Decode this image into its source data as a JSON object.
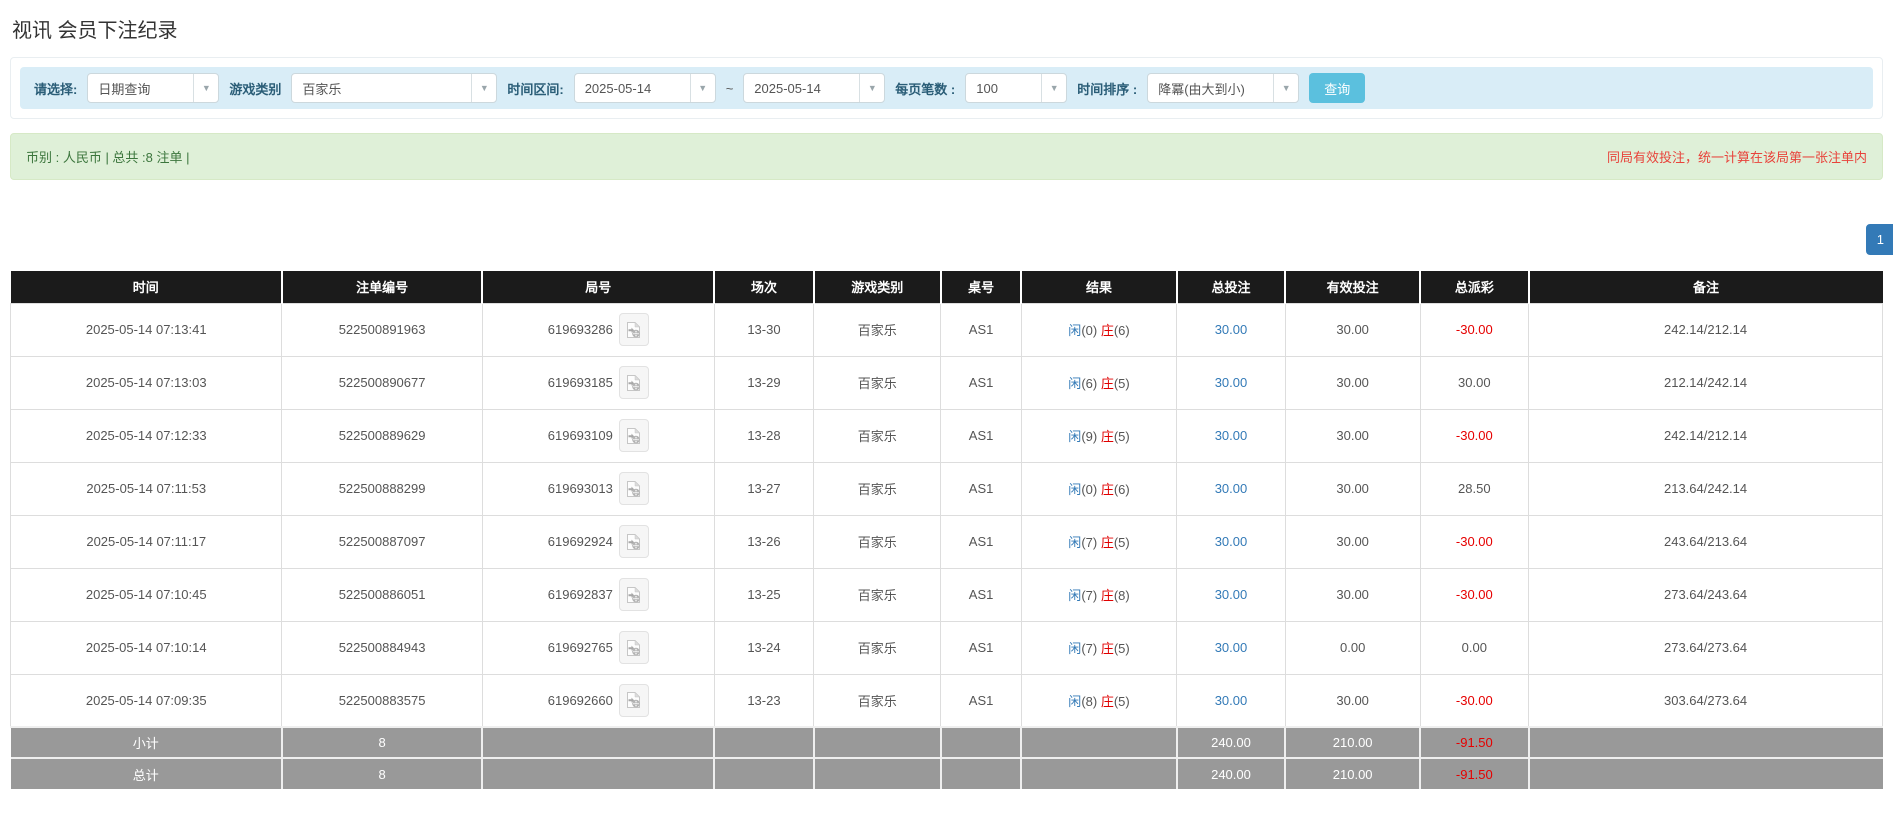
{
  "header": {
    "title": "视讯 会员下注纪录"
  },
  "filters": {
    "query_type": {
      "label": "请选择:",
      "value": "日期查询"
    },
    "game_category": {
      "label": "游戏类别",
      "value": "百家乐"
    },
    "date_range": {
      "label": "时间区间:",
      "from": "2025-05-14",
      "separator": "~",
      "to": "2025-05-14"
    },
    "page_size": {
      "label": "每页笔数 :",
      "value": "100"
    },
    "time_sort": {
      "label": "时间排序 :",
      "value": "降冪(由大到小)"
    },
    "search_button": "查询"
  },
  "summary": {
    "left_text": "币别 : 人民币 | 总共 :8 注单 |",
    "right_notice": "同局有效投注，统一计算在该局第一张注单内"
  },
  "pagination": {
    "current_page": "1"
  },
  "table": {
    "columns": [
      "时间",
      "注单编号",
      "局号",
      "场次",
      "游戏类别",
      "桌号",
      "结果",
      "总投注",
      "有效投注",
      "总派彩",
      "备注"
    ],
    "rows": [
      {
        "time": "2025-05-14 07:13:41",
        "bet_no": "522500891963",
        "round_no": "619693286",
        "session": "13-30",
        "game": "百家乐",
        "table_no": "AS1",
        "result": {
          "player": "闲",
          "player_score": "(0)",
          "banker": "庄",
          "banker_score": "(6)"
        },
        "total_bet": "30.00",
        "valid_bet": "30.00",
        "payout": "-30.00",
        "remark": "242.14/212.14"
      },
      {
        "time": "2025-05-14 07:13:03",
        "bet_no": "522500890677",
        "round_no": "619693185",
        "session": "13-29",
        "game": "百家乐",
        "table_no": "AS1",
        "result": {
          "player": "闲",
          "player_score": "(6)",
          "banker": "庄",
          "banker_score": "(5)"
        },
        "total_bet": "30.00",
        "valid_bet": "30.00",
        "payout": "30.00",
        "remark": "212.14/242.14"
      },
      {
        "time": "2025-05-14 07:12:33",
        "bet_no": "522500889629",
        "round_no": "619693109",
        "session": "13-28",
        "game": "百家乐",
        "table_no": "AS1",
        "result": {
          "player": "闲",
          "player_score": "(9)",
          "banker": "庄",
          "banker_score": "(5)"
        },
        "total_bet": "30.00",
        "valid_bet": "30.00",
        "payout": "-30.00",
        "remark": "242.14/212.14"
      },
      {
        "time": "2025-05-14 07:11:53",
        "bet_no": "522500888299",
        "round_no": "619693013",
        "session": "13-27",
        "game": "百家乐",
        "table_no": "AS1",
        "result": {
          "player": "闲",
          "player_score": "(0)",
          "banker": "庄",
          "banker_score": "(6)"
        },
        "total_bet": "30.00",
        "valid_bet": "30.00",
        "payout": "28.50",
        "remark": "213.64/242.14"
      },
      {
        "time": "2025-05-14 07:11:17",
        "bet_no": "522500887097",
        "round_no": "619692924",
        "session": "13-26",
        "game": "百家乐",
        "table_no": "AS1",
        "result": {
          "player": "闲",
          "player_score": "(7)",
          "banker": "庄",
          "banker_score": "(5)"
        },
        "total_bet": "30.00",
        "valid_bet": "30.00",
        "payout": "-30.00",
        "remark": "243.64/213.64"
      },
      {
        "time": "2025-05-14 07:10:45",
        "bet_no": "522500886051",
        "round_no": "619692837",
        "session": "13-25",
        "game": "百家乐",
        "table_no": "AS1",
        "result": {
          "player": "闲",
          "player_score": "(7)",
          "banker": "庄",
          "banker_score": "(8)"
        },
        "total_bet": "30.00",
        "valid_bet": "30.00",
        "payout": "-30.00",
        "remark": "273.64/243.64"
      },
      {
        "time": "2025-05-14 07:10:14",
        "bet_no": "522500884943",
        "round_no": "619692765",
        "session": "13-24",
        "game": "百家乐",
        "table_no": "AS1",
        "result": {
          "player": "闲",
          "player_score": "(7)",
          "banker": "庄",
          "banker_score": "(5)"
        },
        "total_bet": "30.00",
        "valid_bet": "0.00",
        "payout": "0.00",
        "remark": "273.64/273.64"
      },
      {
        "time": "2025-05-14 07:09:35",
        "bet_no": "522500883575",
        "round_no": "619692660",
        "session": "13-23",
        "game": "百家乐",
        "table_no": "AS1",
        "result": {
          "player": "闲",
          "player_score": "(8)",
          "banker": "庄",
          "banker_score": "(5)"
        },
        "total_bet": "30.00",
        "valid_bet": "30.00",
        "payout": "-30.00",
        "remark": "303.64/273.64"
      }
    ],
    "footer_rows": [
      {
        "label": "小计",
        "count": "8",
        "total_bet": "240.00",
        "valid_bet": "210.00",
        "payout": "-91.50"
      },
      {
        "label": "总计",
        "count": "8",
        "total_bet": "240.00",
        "valid_bet": "210.00",
        "payout": "-91.50"
      }
    ]
  },
  "colors": {
    "accent_blue": "#337ab7",
    "filter_bar_bg": "#d9edf7",
    "search_button_bg": "#5bc0de",
    "summary_bg": "#dff0d8",
    "summary_green_text": "#3c763d",
    "notice_red": "#e8433b",
    "negative_red": "#e60000",
    "table_header_bg": "#1b1b1b",
    "table_footer_bg": "#999999"
  }
}
